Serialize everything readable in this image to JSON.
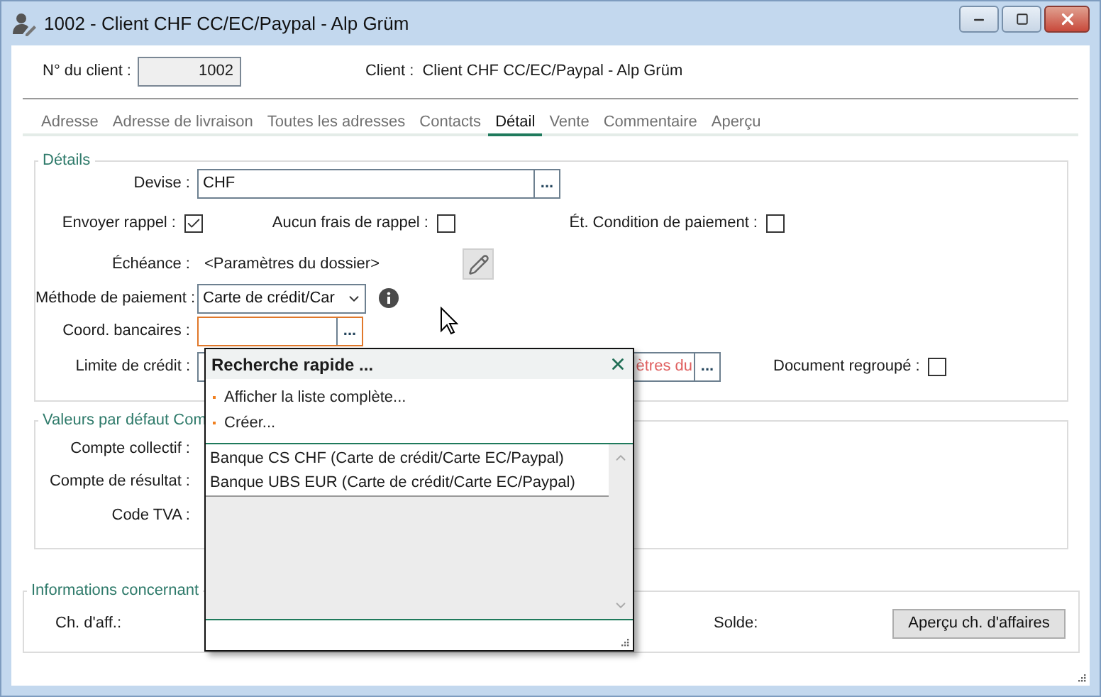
{
  "window": {
    "title": "1002 - Client CHF CC/EC/Paypal - Alp Grüm"
  },
  "header": {
    "client_number_label": "N° du client :",
    "client_number": "1002",
    "client_label": "Client :",
    "client_name": "Client CHF CC/EC/Paypal - Alp Grüm"
  },
  "tabs": [
    {
      "label": "Adresse",
      "selected": false
    },
    {
      "label": "Adresse de livraison",
      "selected": false
    },
    {
      "label": "Toutes les adresses",
      "selected": false
    },
    {
      "label": "Contacts",
      "selected": false
    },
    {
      "label": "Détail",
      "selected": true
    },
    {
      "label": "Vente",
      "selected": false
    },
    {
      "label": "Commentaire",
      "selected": false
    },
    {
      "label": "Aperçu",
      "selected": false
    }
  ],
  "details": {
    "title": "Détails",
    "currency": {
      "label": "Devise :",
      "value": "CHF",
      "button": "..."
    },
    "checkboxes": [
      {
        "label": "Envoyer rappel :",
        "checked": true
      },
      {
        "label": "Aucun frais de rappel :",
        "checked": false
      },
      {
        "label": "Ét. Condition de paiement :",
        "checked": false
      }
    ],
    "due_date": {
      "label": "Échéance :",
      "value": "<Paramètres du dossier>"
    },
    "payment_method": {
      "label": "Méthode de paiement :",
      "value": "Carte de crédit/Car"
    },
    "bank_details": {
      "label": "Coord. bancaires :",
      "button": "..."
    },
    "credit_limit": {
      "label": "Limite de crédit :",
      "value": "ètres du",
      "button": "..."
    },
    "grouped_document": {
      "label": "Document regroupé :",
      "checked": false
    }
  },
  "defaults": {
    "title": "Valeurs par défaut Com",
    "fields": [
      "Compte collectif :",
      "Compte de résultat :",
      "Code TVA :"
    ]
  },
  "info": {
    "title": "Informations concernant",
    "business_label": "Ch. d'aff.:",
    "balance_label": "Solde:",
    "preview_button": "Aperçu ch. d'affaires"
  },
  "quick_search": {
    "title": "Recherche rapide ...",
    "actions": [
      "Afficher la liste complète...",
      "Créer..."
    ],
    "results": [
      "Banque CS CHF (Carte de crédit/Carte EC/Paypal)",
      "Banque UBS EUR (Carte de crédit/Carte EC/Paypal)"
    ]
  }
}
